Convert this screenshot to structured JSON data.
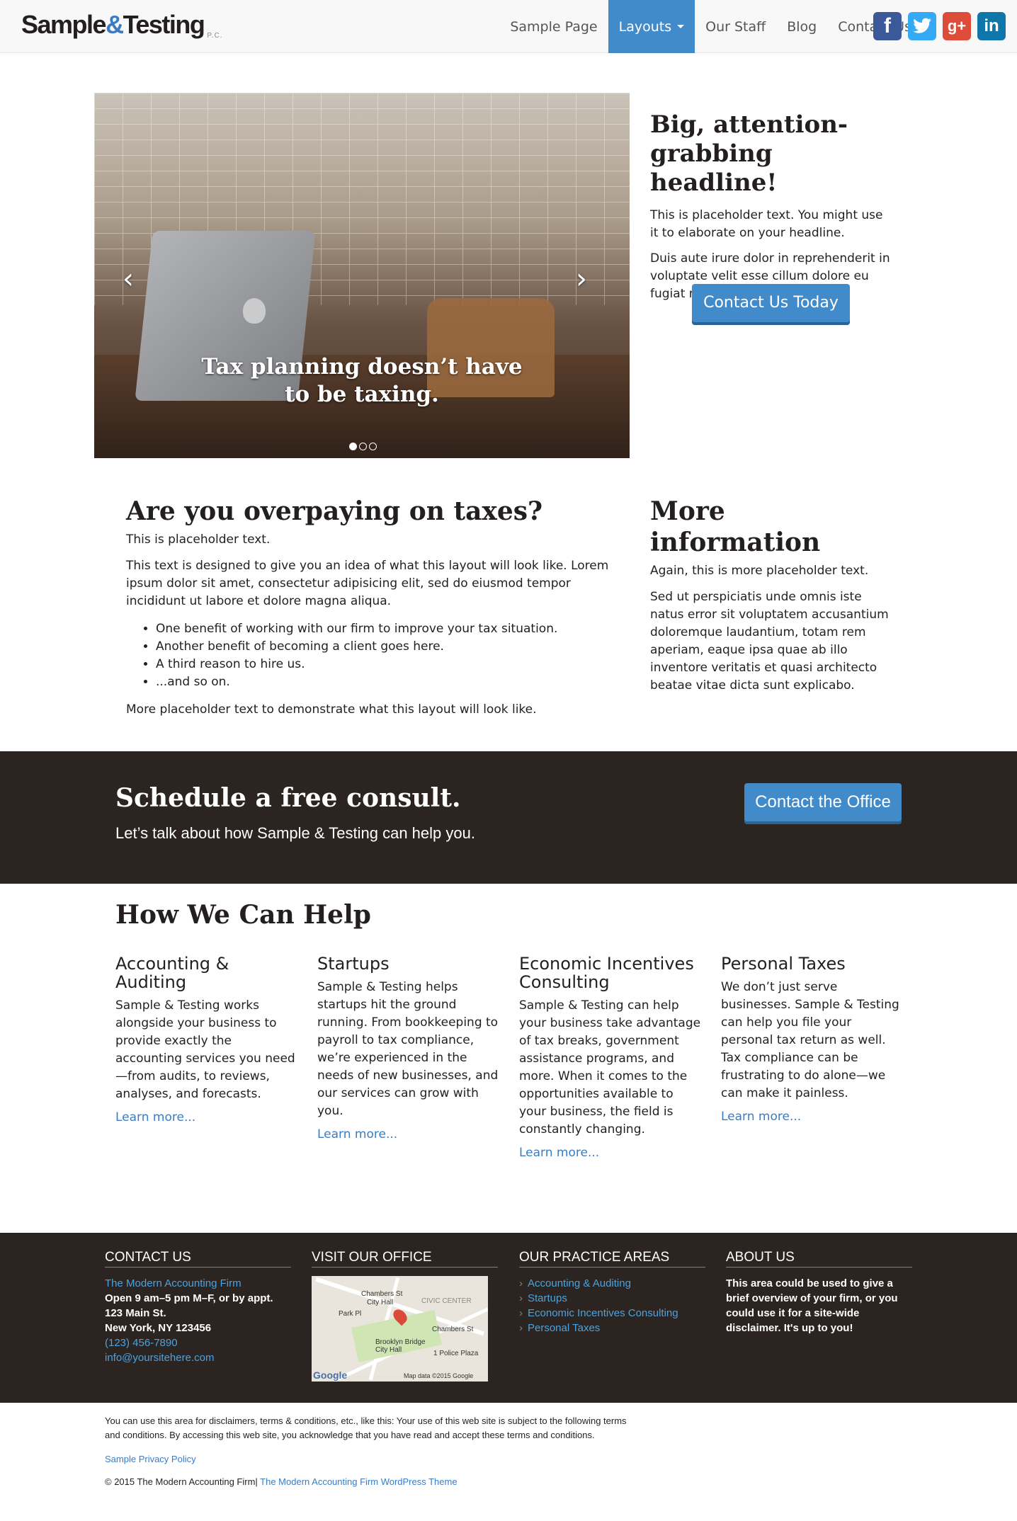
{
  "header": {
    "brand": "Sample",
    "brand_amp": "&",
    "brand_rest": "Testing",
    "brand_suffix": "P.C.",
    "nav": [
      "Sample Page",
      "Layouts",
      "Our Staff",
      "Blog",
      "Contact Us"
    ],
    "active_nav": "Layouts",
    "social": [
      "facebook-icon",
      "twitter-icon",
      "google-plus-icon",
      "linkedin-icon"
    ]
  },
  "hero": {
    "caption": "Tax planning doesn’t have to be taxing.",
    "slides": 3,
    "active_slide": 1,
    "prev_icon": "‹",
    "next_icon": "›",
    "title": "Big, attention-grabbing headline!",
    "p1": "This is placeholder text. You might use it to elaborate on your headline.",
    "p2": "Duis aute irure dolor in reprehenderit in voluptate velit esse cillum dolore eu fugiat nulla pariatur.",
    "cta": "Contact Us Today"
  },
  "main": {
    "title": "Are you overpaying on taxes?",
    "p1": "This is placeholder text.",
    "p2": "This text is designed to give you an idea of what this layout will look like. Lorem ipsum dolor sit amet, consectetur adipisicing elit, sed do eiusmod tempor incididunt ut labore et dolore magna aliqua.",
    "bullets": [
      "One benefit of working with our firm to improve your tax situation.",
      "Another benefit of becoming a client goes here.",
      "A third reason to hire us.",
      "...and so on."
    ],
    "p3": "More placeholder text to demonstrate what this layout will look like."
  },
  "side": {
    "title": "More information",
    "p1": "Again, this is more placeholder text.",
    "p2": "Sed ut perspiciatis unde omnis iste natus error sit voluptatem accusantium doloremque laudantium, totam rem aperiam, eaque ipsa quae ab illo inventore veritatis et quasi architecto beatae vitae dicta sunt explicabo."
  },
  "band": {
    "title": "Schedule a free consult.",
    "subtitle": "Let’s talk about how Sample & Testing can help you.",
    "cta": "Contact the Office"
  },
  "help": {
    "title": "How We Can Help",
    "services": [
      {
        "title": "Accounting & Auditing",
        "text": "Sample & Testing works alongside your business to provide exactly the accounting services you need—from audits, to reviews, analyses, and forecasts.",
        "link": "Learn more..."
      },
      {
        "title": "Startups",
        "text": "Sample & Testing helps startups hit the ground running. From bookkeeping to payroll to tax compliance, we’re experienced in the needs of new businesses, and our services can grow with you.",
        "link": "Learn more..."
      },
      {
        "title": "Economic Incentives Consulting",
        "text": "Sample & Testing can help your business take advantage of tax breaks, government assistance programs, and more. When it comes to the opportunities available to your business, the field is constantly changing.",
        "link": "Learn more..."
      },
      {
        "title": "Personal Taxes",
        "text": "We don’t just serve businesses. Sample & Testing can help you file your personal tax return as well. Tax compliance can be frustrating to do alone—we can make it painless.",
        "link": "Learn more..."
      }
    ]
  },
  "footer": {
    "contact": {
      "heading": "CONTACT US",
      "firm": "The Modern Accounting Firm",
      "hours": "Open 9 am–5 pm M–F, or by appt.",
      "street": "123 Main St.",
      "city": "New York, NY 123456",
      "phone": "(123) 456-7890",
      "email": "info@yoursitehere.com"
    },
    "office": {
      "heading": "VISIT OUR OFFICE",
      "map_labels": [
        "Chambers St",
        "City Hall",
        "CIVIC CENTER",
        "Park Pl",
        "Chambers St",
        "Brooklyn Bridge City Hall",
        "1 Police Plaza"
      ],
      "map_logo": "Google",
      "map_credit": "Map data ©2015 Google"
    },
    "practice": {
      "heading": "OUR PRACTICE AREAS",
      "items": [
        "Accounting & Auditing",
        "Startups",
        "Economic Incentives Consulting",
        "Personal Taxes"
      ]
    },
    "about": {
      "heading": "ABOUT US",
      "text": "This area could be used to give a brief overview of your firm, or you could use it for a site-wide disclaimer. It's up to you!"
    }
  },
  "subfooter": {
    "disclaimer": "You can use this area for disclaimers, terms & conditions, etc., like this: Your use of this web site is subject to the following terms and conditions. By accessing this web site, you acknowledge that you have read and accept these terms and conditions.",
    "privacy": "Sample Privacy Policy",
    "copyright": "© 2015 The Modern Accounting Firm|",
    "theme_link": "The Modern Accounting Firm WordPress Theme"
  }
}
